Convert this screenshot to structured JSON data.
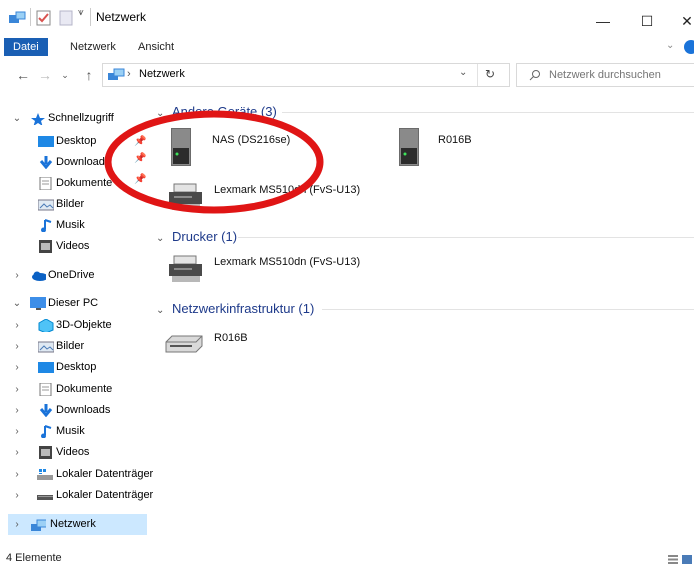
{
  "window": {
    "title": "Netzwerk"
  },
  "title_bar": {
    "minimize": "—",
    "maximize": "☐",
    "close": "✕"
  },
  "ribbon": {
    "tabs": [
      "Datei",
      "Netzwerk",
      "Ansicht"
    ],
    "collapse": "⌄"
  },
  "address": {
    "path": "Netzwerk",
    "separator": "›",
    "dropdown": "⌄",
    "refresh": "↻"
  },
  "search": {
    "placeholder": "Netzwerk durchsuchen"
  },
  "nav": {
    "quick_access": "Schnellzugriff",
    "quick_items": [
      "Desktop",
      "Downloads",
      "Dokumente",
      "Bilder",
      "Musik",
      "Videos"
    ],
    "onedrive": "OneDrive",
    "this_pc": "Dieser PC",
    "pc_items": [
      "3D-Objekte",
      "Bilder",
      "Desktop",
      "Dokumente",
      "Downloads",
      "Musik",
      "Videos",
      "Lokaler Datenträger",
      "Lokaler Datenträger"
    ],
    "network": "Netzwerk"
  },
  "groups": [
    {
      "title": "Andere Geräte (3)",
      "items": [
        "NAS (DS216se)",
        "R016B",
        "Lexmark MS510dn (FvS-U13)"
      ]
    },
    {
      "title": "Drucker (1)",
      "items": [
        "Lexmark MS510dn (FvS-U13)"
      ]
    },
    {
      "title": "Netzwerkinfrastruktur (1)",
      "items": [
        "R016B"
      ]
    }
  ],
  "status": {
    "count": "4 Elemente"
  },
  "colors": {
    "accent": "#1a5fb4",
    "annotation": "#e01515",
    "group_header": "#1e3a8a",
    "selection": "#cce8ff"
  }
}
